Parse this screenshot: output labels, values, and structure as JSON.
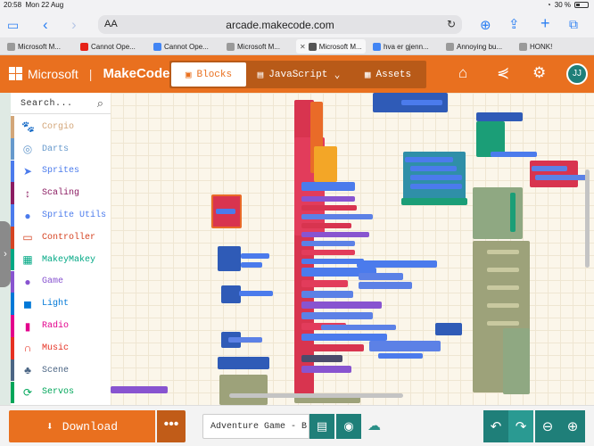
{
  "status": {
    "time": "20:58",
    "date": "Mon 22 Aug",
    "battery": "30 %",
    "battery_level": 0.3
  },
  "browser": {
    "text_size_label": "AA",
    "url": "arcade.makecode.com",
    "tabs": [
      {
        "label": "Microsoft M...",
        "favicon_color": "#9a9a9a",
        "active": false
      },
      {
        "label": "Cannot Ope...",
        "favicon_color": "#e62117",
        "active": false
      },
      {
        "label": "Cannot Ope...",
        "favicon_color": "#4285f4",
        "active": false
      },
      {
        "label": "Microsoft M...",
        "favicon_color": "#9a9a9a",
        "active": false
      },
      {
        "label": "Microsoft M...",
        "favicon_color": "#555555",
        "active": true
      },
      {
        "label": "hva er gjenn...",
        "favicon_color": "#4285f4",
        "active": false
      },
      {
        "label": "Annoying bu...",
        "favicon_color": "#9a9a9a",
        "active": false
      },
      {
        "label": "HONK!",
        "favicon_color": "#9a9a9a",
        "active": false
      }
    ]
  },
  "header": {
    "company": "Microsoft",
    "product": "MakeCode",
    "modes": [
      {
        "label": "Blocks",
        "icon": "puzzle-icon",
        "active": true
      },
      {
        "label": "JavaScript",
        "icon": "js-icon",
        "active": false
      },
      {
        "label": "Assets",
        "icon": "assets-icon",
        "active": false
      }
    ],
    "avatar": "JJ",
    "accent": "#e9701f"
  },
  "toolbox": {
    "search_placeholder": "Search...",
    "categories": [
      {
        "label": "Corgio",
        "color": "#d3a679",
        "icon": "paw-icon"
      },
      {
        "label": "Darts",
        "color": "#6699cc",
        "icon": "target-icon"
      },
      {
        "label": "Sprites",
        "color": "#4b7bec",
        "icon": "paper-plane-icon"
      },
      {
        "label": "Scaling",
        "color": "#8b1c62",
        "icon": "arrows-icon"
      },
      {
        "label": "Sprite Utils",
        "color": "#4b7bec",
        "icon": "user-icon"
      },
      {
        "label": "Controller",
        "color": "#d54322",
        "icon": "gamepad-icon"
      },
      {
        "label": "MakeyMakey",
        "color": "#00a884",
        "icon": "keyboard-icon"
      },
      {
        "label": "Game",
        "color": "#8854d0",
        "icon": "circle-icon"
      },
      {
        "label": "Light",
        "color": "#0078d7",
        "icon": "light-icon"
      },
      {
        "label": "Radio",
        "color": "#e3008c",
        "icon": "signal-icon"
      },
      {
        "label": "Music",
        "color": "#e63022",
        "icon": "headphones-icon"
      },
      {
        "label": "Scene",
        "color": "#4b6584",
        "icon": "tree-icon"
      },
      {
        "label": "Servos",
        "color": "#00a65a",
        "icon": "refresh-icon"
      }
    ]
  },
  "footer": {
    "download_label": "Download",
    "more_label": "•••",
    "project_name": "Adventure Game - BETA"
  }
}
